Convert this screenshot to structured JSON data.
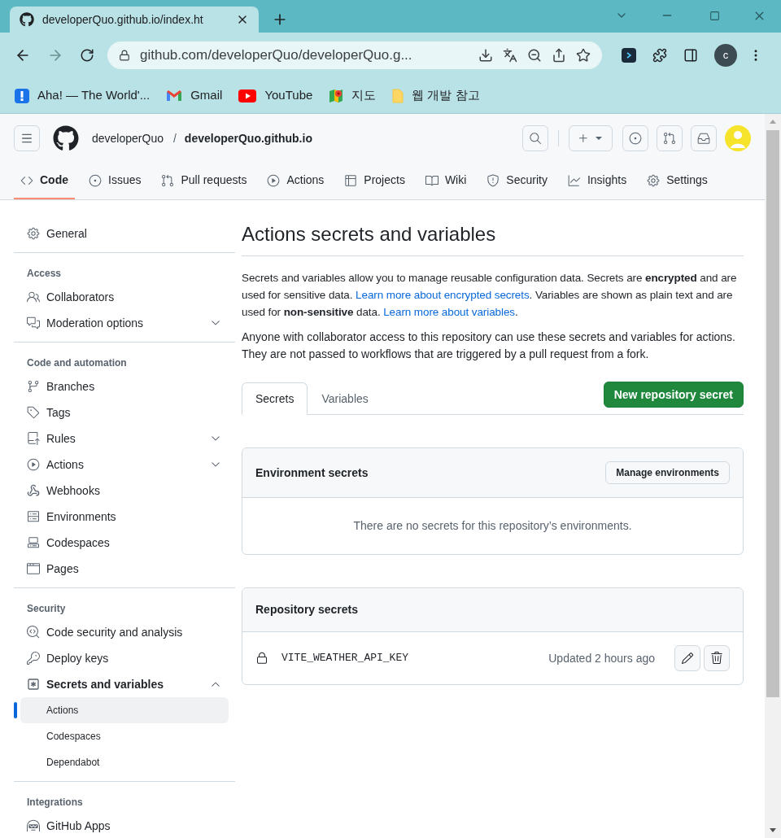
{
  "browser": {
    "tab": {
      "title": "developerQuo.github.io/index.ht",
      "selected": true
    },
    "address": "github.com/developerQuo/developerQuo.g...",
    "profile": "c",
    "bookmarks": [
      {
        "label": "Aha! — The World'..."
      },
      {
        "label": "Gmail"
      },
      {
        "label": "YouTube"
      },
      {
        "label": "지도"
      },
      {
        "label": "웹 개발 참고"
      }
    ]
  },
  "header": {
    "owner": "developerQuo",
    "separator": "/",
    "repo": "developerQuo.github.io"
  },
  "repo_tabs": [
    {
      "label": "Code",
      "selected": true
    },
    {
      "label": "Issues",
      "selected": false
    },
    {
      "label": "Pull requests",
      "selected": false
    },
    {
      "label": "Actions",
      "selected": false
    },
    {
      "label": "Projects",
      "selected": false
    },
    {
      "label": "Wiki",
      "selected": false
    },
    {
      "label": "Security",
      "selected": false
    },
    {
      "label": "Insights",
      "selected": false
    },
    {
      "label": "Settings",
      "selected": false
    }
  ],
  "sidebar": {
    "sections": [
      {
        "items": [
          {
            "label": "General",
            "selected": false
          }
        ]
      },
      {
        "heading": "Access",
        "items": [
          {
            "label": "Collaborators",
            "selected": false
          },
          {
            "label": "Moderation options",
            "selected": false,
            "expanded": false
          }
        ]
      },
      {
        "heading": "Code and automation",
        "items": [
          {
            "label": "Branches",
            "selected": false
          },
          {
            "label": "Tags",
            "selected": false
          },
          {
            "label": "Rules",
            "selected": false,
            "expanded": false
          },
          {
            "label": "Actions",
            "selected": false,
            "expanded": false
          },
          {
            "label": "Webhooks",
            "selected": false
          },
          {
            "label": "Environments",
            "selected": false
          },
          {
            "label": "Codespaces",
            "selected": false
          },
          {
            "label": "Pages",
            "selected": false
          }
        ]
      },
      {
        "heading": "Security",
        "items": [
          {
            "label": "Code security and analysis",
            "selected": false
          },
          {
            "label": "Deploy keys",
            "selected": false
          },
          {
            "label": "Secrets and variables",
            "selected": false,
            "expanded": true,
            "children": [
              {
                "label": "Actions",
                "selected": true
              },
              {
                "label": "Codespaces",
                "selected": false
              },
              {
                "label": "Dependabot",
                "selected": false
              }
            ]
          }
        ]
      },
      {
        "heading": "Integrations",
        "items": [
          {
            "label": "GitHub Apps",
            "selected": false
          }
        ]
      }
    ]
  },
  "main": {
    "title": "Actions secrets and variables",
    "intro": [
      {
        "kind": "text",
        "text": "Secrets and variables allow you to manage reusable configuration data. Secrets are **encrypted** and are used for sensitive data. "
      },
      {
        "kind": "link",
        "text": "Learn more about encrypted secrets"
      },
      {
        "kind": "text",
        "text": ". Variables are shown as plain text and are used for **non-sensitive** data. "
      },
      {
        "kind": "link",
        "text": "Learn more about variables"
      },
      {
        "kind": "text",
        "text": "."
      }
    ],
    "note": "Anyone with collaborator access to this repository can use these secrets and variables for actions. They are not passed to workflows that are triggered by a pull request from a fork.",
    "tabs": [
      {
        "label": "Secrets",
        "selected": true
      },
      {
        "label": "Variables",
        "selected": false
      }
    ],
    "new_button": "New repository secret",
    "environment_secrets": {
      "title": "Environment secrets",
      "button": "Manage environments",
      "empty": "There are no secrets for this repository’s environments."
    },
    "repository_secrets": {
      "title": "Repository secrets",
      "rows": [
        {
          "name": "VITE_WEATHER_API_KEY",
          "updated": "Updated 2 hours ago"
        }
      ]
    }
  }
}
